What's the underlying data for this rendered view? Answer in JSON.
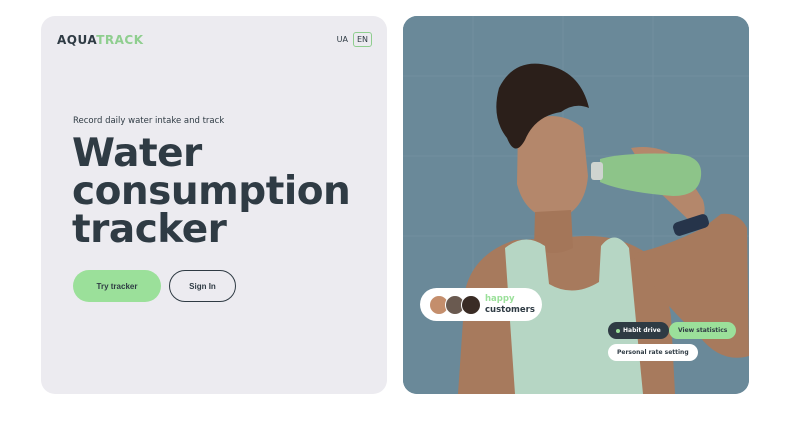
{
  "header": {
    "logo_main": "AQUA",
    "logo_accent": "TRACK",
    "lang_ua": "UA",
    "lang_en": "EN"
  },
  "hero": {
    "subtitle": "Record daily water intake and track",
    "headline_line1": "Water",
    "headline_line2": "consumption",
    "headline_line3": "tracker",
    "try_button": "Try tracker",
    "sign_in_button": "Sign In"
  },
  "photo_card": {
    "happy_label": "happy",
    "customers_label": "customers",
    "tag_habit": "Habit drive",
    "tag_stats": "View statistics",
    "tag_rate": "Personal rate setting"
  },
  "colors": {
    "accent": "#9be09a",
    "dark": "#2f3b44",
    "card_bg": "#ecebf0",
    "photo_bg": "#6c8b9b"
  }
}
